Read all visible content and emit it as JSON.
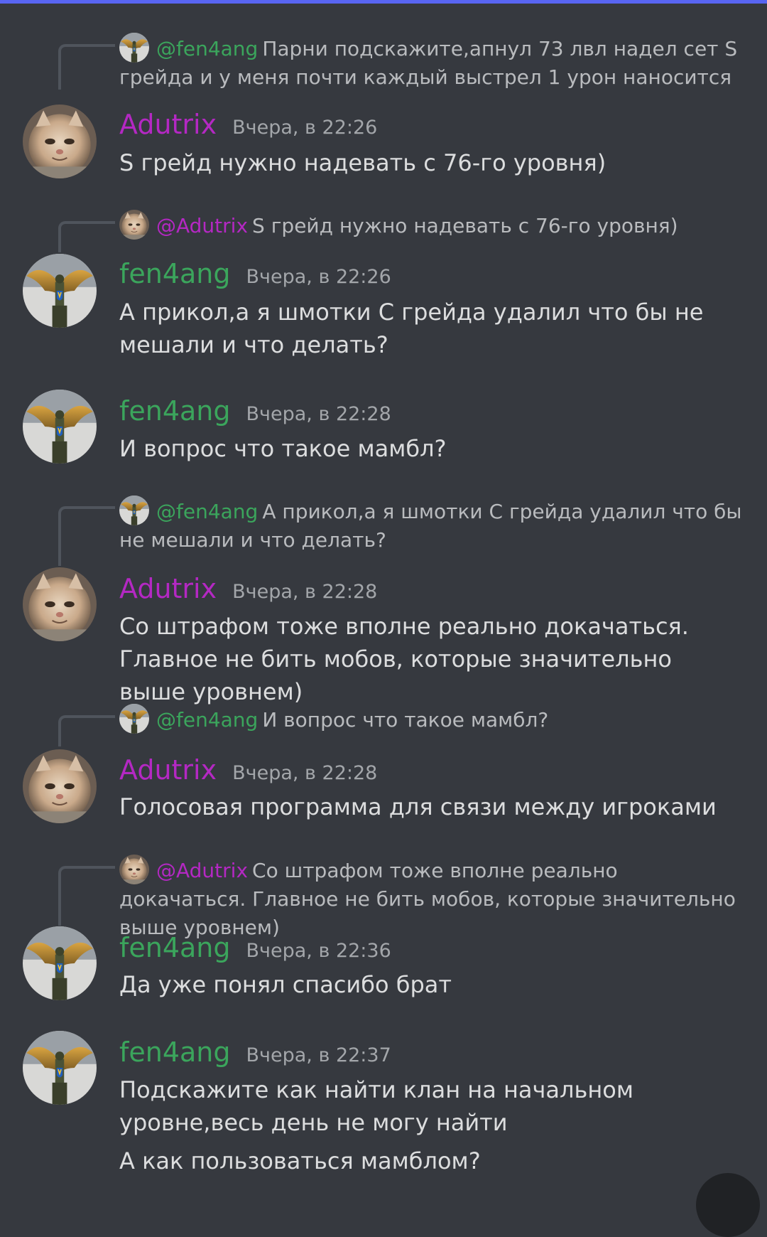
{
  "colors": {
    "background": "#36393f",
    "accent": "#5865f2",
    "adutrix_name": "#b428c3",
    "fen4ang_name": "#3ba55c",
    "message_text": "#dcddde",
    "timestamp": "#a3a6aa"
  },
  "messages": [
    {
      "reply": {
        "mention": "@fen4ang",
        "text": "Парни подскажите,апнул 73 лвл надел сет S грейда и у меня почти каждый выстрел 1 урон наносится"
      },
      "author": "Adutrix",
      "time": "Вчера, в 22:26",
      "lines": [
        "S грейд нужно надевать с 76-го уровня)"
      ]
    },
    {
      "reply": {
        "mention": "@Adutrix",
        "text": "S грейд нужно надевать с 76-го уровня)"
      },
      "author": "fen4ang",
      "time": "Вчера, в 22:26",
      "lines": [
        "А прикол,а я шмотки С грейда удалил что бы не мешали и что делать?"
      ]
    },
    {
      "author": "fen4ang",
      "time": "Вчера, в 22:28",
      "lines": [
        "И вопрос что такое мамбл?"
      ]
    },
    {
      "reply": {
        "mention": "@fen4ang",
        "text": "А прикол,а я шмотки С грейда удалил что бы не мешали и что делать?"
      },
      "author": "Adutrix",
      "time": "Вчера, в 22:28",
      "lines": [
        "Со штрафом тоже вполне реально докачаться. Главное не бить мобов, которые значительно выше уровнем)"
      ]
    },
    {
      "reply": {
        "mention": "@fen4ang",
        "text": "И вопрос что такое мамбл?"
      },
      "author": "Adutrix",
      "time": "Вчера, в 22:28",
      "lines": [
        "Голосовая программа для связи между игроками"
      ]
    },
    {
      "reply": {
        "mention": "@Adutrix",
        "text": "Со штрафом тоже вполне реально докачаться. Главное не бить мобов, которые значительно выше уровнем)"
      },
      "author": "fen4ang",
      "time": "Вчера, в 22:36",
      "lines": [
        "Да уже понял спасибо брат"
      ]
    },
    {
      "author": "fen4ang",
      "time": "Вчера, в 22:37",
      "lines": [
        "Подскажите как найти клан на начальном уровне,весь день не могу найти",
        "А как пользоваться мамблом?"
      ]
    }
  ]
}
